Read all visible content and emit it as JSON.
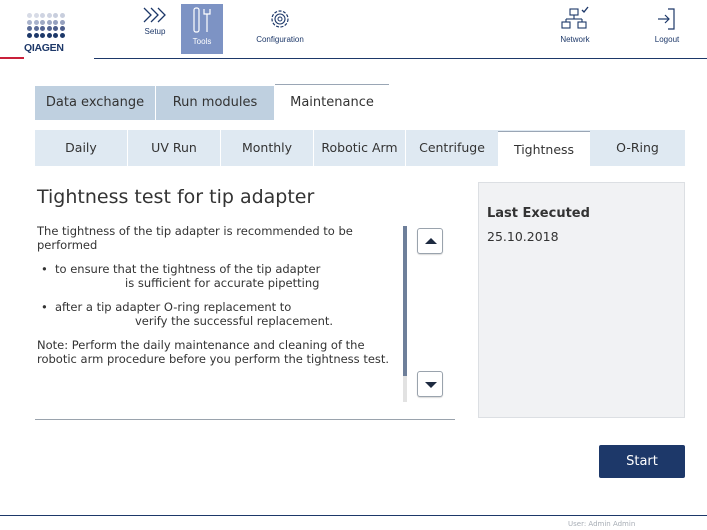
{
  "brand": {
    "logo_text": "QIAGEN",
    "accent_red": "#c9203a",
    "navy": "#1d3869",
    "logo_icon": "qiagen-logo"
  },
  "header": {
    "buttons": [
      {
        "label": "Setup",
        "icon": "setup-chevrons-icon",
        "active": false
      },
      {
        "label": "Tools",
        "icon": "tools-icon",
        "active": true
      },
      {
        "label": "Configuration",
        "icon": "configuration-gear-icon",
        "active": false
      },
      {
        "label": "Network",
        "icon": "network-icon",
        "active": false
      },
      {
        "label": "Logout",
        "icon": "logout-icon",
        "active": false
      }
    ]
  },
  "top_tabs": [
    {
      "label": "Data exchange",
      "active": false
    },
    {
      "label": "Run modules",
      "active": false
    },
    {
      "label": "Maintenance",
      "active": true
    }
  ],
  "sub_tabs": [
    {
      "label": "Daily",
      "active": false
    },
    {
      "label": "UV Run",
      "active": false
    },
    {
      "label": "Monthly",
      "active": false
    },
    {
      "label": "Robotic Arm",
      "active": false
    },
    {
      "label": "Centrifuge",
      "active": false
    },
    {
      "label": "Tightness",
      "active": true
    },
    {
      "label": "O-Ring",
      "active": false
    }
  ],
  "main": {
    "title": "Tightness test for tip adapter",
    "intro": "The tightness of the tip adapter is recommended to be performed",
    "bullets": [
      {
        "line1": "to ensure that the tightness of the tip adapter",
        "line2": "is sufficient for accurate pipetting"
      },
      {
        "line1": "after a tip adapter O-ring replacement to",
        "line2": "verify the successful replacement."
      }
    ],
    "bullet_symbol": "•",
    "note": "Note: Perform the daily maintenance and cleaning of the robotic arm procedure before you perform the tightness test."
  },
  "panel": {
    "heading": "Last Executed",
    "value": "25.10.2018"
  },
  "actions": {
    "start_label": "Start"
  },
  "footer": {
    "user_text": "User: Admin Admin"
  }
}
